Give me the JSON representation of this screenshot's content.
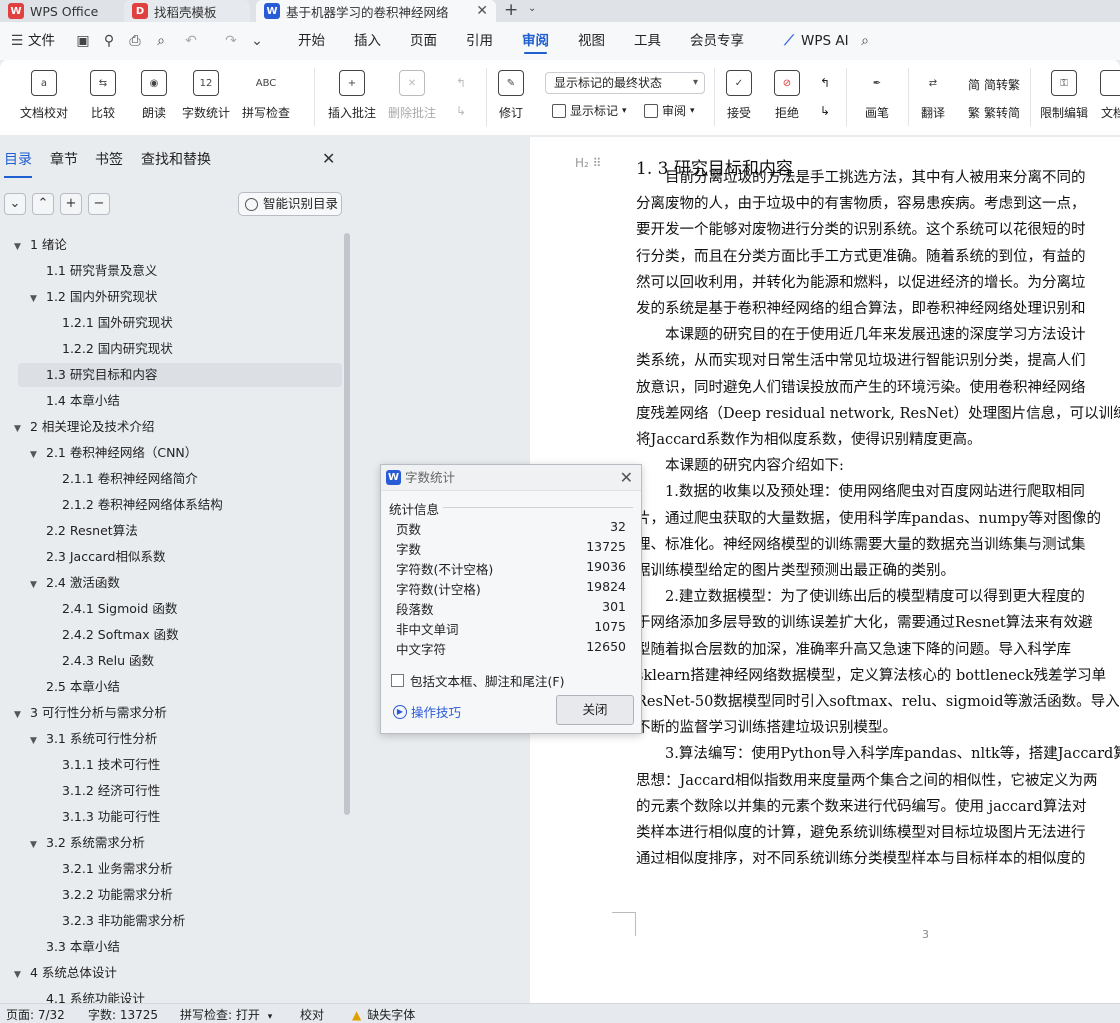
{
  "tabs": [
    {
      "label": "WPS Office",
      "logo": "W",
      "logo_color": "#e04040"
    },
    {
      "label": "找稻壳模板",
      "logo": "D",
      "logo_color": "#e04040"
    },
    {
      "label": "基于机器学习的卷积神经网络",
      "logo": "W",
      "logo_color": "#2a5bd7"
    }
  ],
  "menu": {
    "file": "文件",
    "items": [
      "开始",
      "插入",
      "页面",
      "引用",
      "审阅",
      "视图",
      "工具",
      "会员专享"
    ],
    "active": "审阅",
    "ai": "WPS AI"
  },
  "ribbon": {
    "proofread": "文档校对",
    "compare": "比较",
    "read_aloud": "朗读",
    "word_count": "字数统计",
    "spell_check": "拼写检查",
    "insert_comment": "插入批注",
    "delete_comment": "删除批注",
    "revise": "修订",
    "display_combo": "显示标记的最终状态",
    "show_markup": "显示标记",
    "review": "审阅",
    "accept": "接受",
    "reject": "拒绝",
    "ink": "画笔",
    "translate": "翻译",
    "to_traditional": "简转繁",
    "to_simplified": "繁转简",
    "restrict_edit": "限制编辑",
    "doc_more": "文档"
  },
  "nav": {
    "tabs": [
      "目录",
      "章节",
      "书签",
      "查找和替换"
    ],
    "smart_toc": "智能识别目录",
    "toc": [
      {
        "text": "1  绪论",
        "level": 0,
        "toggle": "▼"
      },
      {
        "text": "1.1  研究背景及意义",
        "level": 1,
        "toggle": ""
      },
      {
        "text": "1.2  国内外研究现状",
        "level": 1,
        "toggle": "▼"
      },
      {
        "text": "1.2.1  国外研究现状",
        "level": 2,
        "toggle": ""
      },
      {
        "text": "1.2.2  国内研究现状",
        "level": 2,
        "toggle": ""
      },
      {
        "text": "1.3  研究目标和内容",
        "level": 1,
        "toggle": "",
        "selected": true
      },
      {
        "text": "1.4  本章小结",
        "level": 1,
        "toggle": ""
      },
      {
        "text": "2  相关理论及技术介绍",
        "level": 0,
        "toggle": "▼"
      },
      {
        "text": "2.1  卷积神经网络（CNN）",
        "level": 1,
        "toggle": "▼"
      },
      {
        "text": "2.1.1  卷积神经网络简介",
        "level": 2,
        "toggle": ""
      },
      {
        "text": "2.1.2  卷积神经网络体系结构",
        "level": 2,
        "toggle": ""
      },
      {
        "text": "2.2 Resnet算法",
        "level": 1,
        "toggle": ""
      },
      {
        "text": "2.3 Jaccard相似系数",
        "level": 1,
        "toggle": ""
      },
      {
        "text": "2.4  激活函数",
        "level": 1,
        "toggle": "▼"
      },
      {
        "text": "2.4.1 Sigmoid 函数",
        "level": 2,
        "toggle": ""
      },
      {
        "text": "2.4.2 Softmax 函数",
        "level": 2,
        "toggle": ""
      },
      {
        "text": "2.4.3 Relu 函数",
        "level": 2,
        "toggle": ""
      },
      {
        "text": "2.5  本章小结",
        "level": 1,
        "toggle": ""
      },
      {
        "text": "3 可行性分析与需求分析",
        "level": 0,
        "toggle": "▼"
      },
      {
        "text": "3.1  系统可行性分析",
        "level": 1,
        "toggle": "▼"
      },
      {
        "text": "3.1.1 技术可行性",
        "level": 2,
        "toggle": ""
      },
      {
        "text": "3.1.2  经济可行性",
        "level": 2,
        "toggle": ""
      },
      {
        "text": "3.1.3  功能可行性",
        "level": 2,
        "toggle": ""
      },
      {
        "text": "3.2  系统需求分析",
        "level": 1,
        "toggle": "▼"
      },
      {
        "text": "3.2.1  业务需求分析",
        "level": 2,
        "toggle": ""
      },
      {
        "text": "3.2.2  功能需求分析",
        "level": 2,
        "toggle": ""
      },
      {
        "text": "3.2.3  非功能需求分析",
        "level": 2,
        "toggle": ""
      },
      {
        "text": "3.3  本章小结",
        "level": 1,
        "toggle": ""
      },
      {
        "text": "4  系统总体设计",
        "level": 0,
        "toggle": "▼"
      },
      {
        "text": "4.1  系统功能设计",
        "level": 1,
        "toggle": ""
      }
    ]
  },
  "doc": {
    "heading": "1. 3  研究目标和内容",
    "lines": [
      "　　目前分离垃圾的方法是手工挑选方法，其中有人被用来分离不同的",
      "分离废物的人，由于垃圾中的有害物质，容易患疾病。考虑到这一点，",
      "要开发一个能够对废物进行分类的识别系统。这个系统可以花很短的时",
      "行分类，而且在分类方面比手工方式更准确。随着系统的到位，有益的",
      "然可以回收利用，并转化为能源和燃料，以促进经济的增长。为分离垃",
      "发的系统是基于卷积神经网络的组合算法，即卷积神经网络处理识别和",
      "　　本课题的研究目的在于使用近几年来发展迅速的深度学习方法设计",
      "类系统，从而实现对日常生活中常见垃圾进行智能识别分类，提高人们",
      "放意识，同时避免人们错误投放而产生的环境污染。使用卷积神经网络",
      "度残差网络（Deep residual network, ResNet）处理图片信息，可以训练出",
      "将Jaccard系数作为相似度系数，使得识别精度更高。",
      "　　本课题的研究内容介绍如下:",
      "　　1.数据的收集以及预处理：使用网络爬虫对百度网站进行爬取相同",
      "片，通过爬虫获取的大量数据，使用科学库pandas、numpy等对图像的",
      "理、标准化。神经网络模型的训练需要大量的数据充当训练集与测试集",
      "据训练模型给定的图片类型预测出最正确的类别。",
      "　　2.建立数据模型：为了使训练出后的模型精度可以得到更大程度的",
      "于网络添加多层导致的训练误差扩大化，需要通过Resnet算法来有效避",
      "型随着拟合层数的加深，准确率升高又急速下降的问题。导入科学库",
      "sklearn搭建神经网络数据模型，定义算法核心的 bottleneck残差学习单",
      "ResNet-50数据模型同时引入softmax、relu、sigmoid等激活函数。导入",
      "不断的监督学习训练搭建垃圾识别模型。",
      "　　3.算法编写：使用Python导入科学库pandas、nltk等，搭建Jaccard算",
      "思想：Jaccard相似指数用来度量两个集合之间的相似性，它被定义为两",
      "的元素个数除以并集的元素个数来进行代码编写。使用 jaccard算法对",
      "类样本进行相似度的计算，避免系统训练模型对目标垃圾图片无法进行",
      "通过相似度排序，对不同系统训练分类模型样本与目标样本的相似度的"
    ],
    "page_number": "3"
  },
  "dialog": {
    "title": "字数统计",
    "group": "统计信息",
    "stats": [
      {
        "label": "页数",
        "value": "32"
      },
      {
        "label": "字数",
        "value": "13725"
      },
      {
        "label": "字符数(不计空格)",
        "value": "19036"
      },
      {
        "label": "字符数(计空格)",
        "value": "19824"
      },
      {
        "label": "段落数",
        "value": "301"
      },
      {
        "label": "非中文单词",
        "value": "1075"
      },
      {
        "label": "中文字符",
        "value": "12650"
      }
    ],
    "include_label": "包括文本框、脚注和尾注(F)",
    "tips": "操作技巧",
    "close": "关闭"
  },
  "status": {
    "page": "页面: 7/32",
    "words": "字数: 13725",
    "spell": "拼写检查: 打开",
    "proof": "校对",
    "missing_font": "缺失字体"
  }
}
